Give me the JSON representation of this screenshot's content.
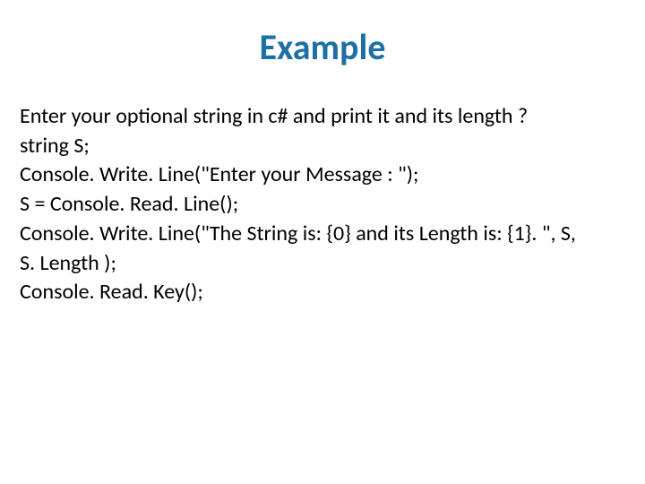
{
  "title": "Example",
  "lines": {
    "l0": "Enter your optional string in c# and  print it  and its length ?",
    "l1": "string S;",
    "l2": "Console. Write. Line(\"Enter your Message : \");",
    "l3": "S = Console. Read. Line();",
    "l4": "Console. Write. Line(\"The String is: {0} and its Length is: {1}. \", S,",
    "l5": "S. Length );",
    "l6": "Console. Read. Key();"
  }
}
